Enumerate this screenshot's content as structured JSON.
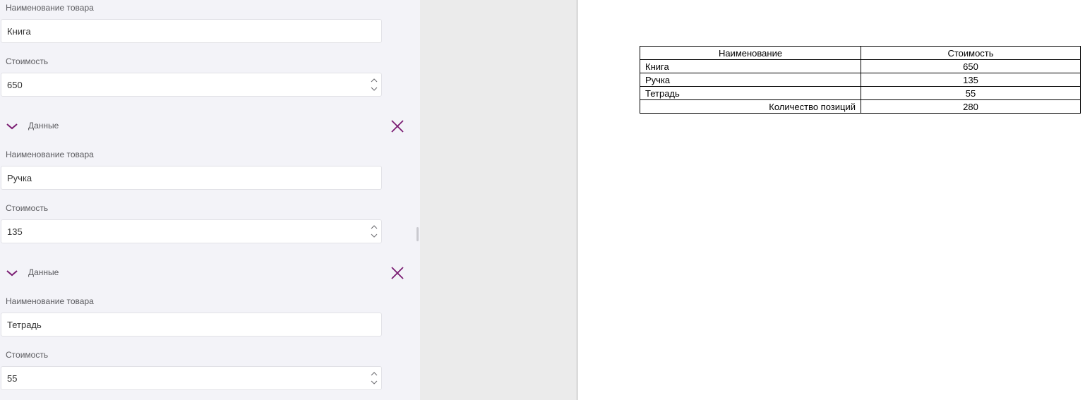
{
  "form": {
    "field_labels": {
      "name": "Наименование товара",
      "cost": "Стоимость"
    },
    "group_title": "Данные",
    "items": [
      {
        "name": "Книга",
        "cost": "650"
      },
      {
        "name": "Ручка",
        "cost": "135"
      },
      {
        "name": "Тетрадь",
        "cost": "55"
      }
    ]
  },
  "icons": {
    "expand": "chevron-down-icon",
    "remove": "close-icon",
    "spin_up": "chevron-up-icon",
    "spin_down": "chevron-down-icon"
  },
  "colors": {
    "accent": "#7a1c72",
    "panel_bg": "#f3f3f8",
    "gutter_bg": "#ebebeb"
  },
  "table": {
    "headers": [
      "Наименование",
      "Стоимость"
    ],
    "rows": [
      {
        "name": "Книга",
        "cost": "650"
      },
      {
        "name": "Ручка",
        "cost": "135"
      },
      {
        "name": "Тетрадь",
        "cost": "55"
      }
    ],
    "total_label": "Количество позиций",
    "total_value": "280"
  }
}
